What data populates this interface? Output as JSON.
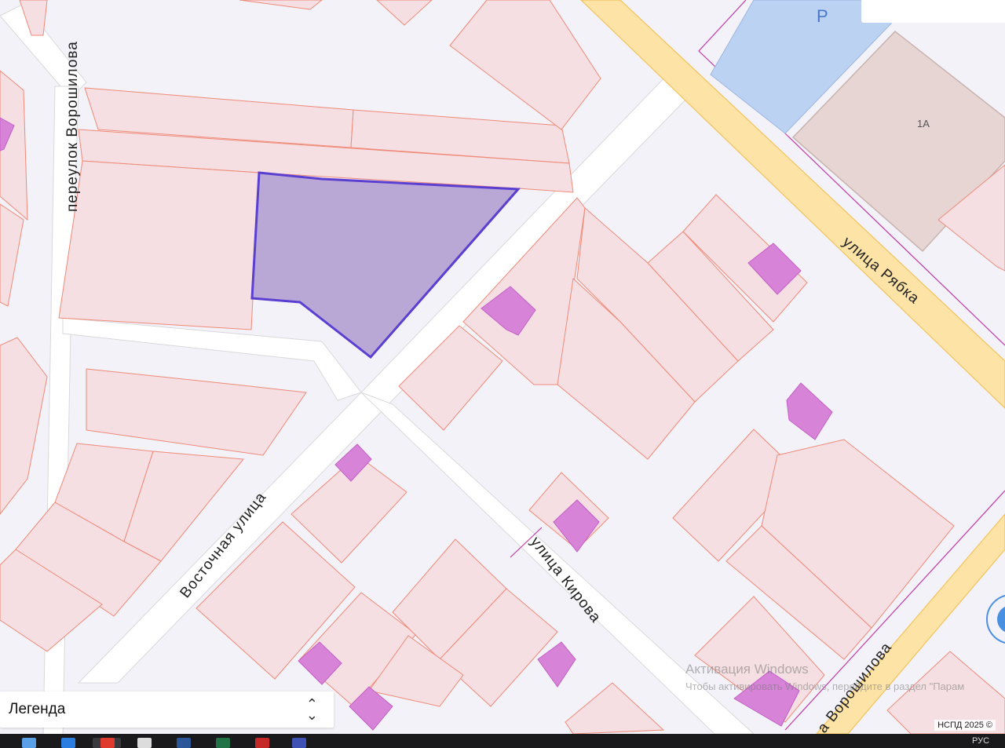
{
  "map": {
    "streets": {
      "vostochnaya": "Восточная улица",
      "kirova": "улица Кирова",
      "ryabka": "улица Рябка",
      "pereulok": "переулок Ворошилова",
      "voroshilova_cut": "а Ворошилова"
    },
    "parking_label": "P",
    "building_label": "1А",
    "selected_parcel_color": "#b9a8d6",
    "selected_parcel_stroke": "#5b3fd1",
    "parcel_fill": "#f5dfe2",
    "parcel_stroke": "#f08a78",
    "building_fill": "#d784d8",
    "road_color": "#fde3a6",
    "parking_color": "#bcd2f3"
  },
  "legend": {
    "label": "Легенда",
    "toggle_icon": "chevron-updown-icon"
  },
  "copyright": "НСПД 2025 ©",
  "watermark": {
    "title": "Активация Windows",
    "subtitle": "Чтобы активировать Windows, перейдите в раздел \"Парам"
  },
  "taskbar": {
    "icons": [
      "notes-icon",
      "edge-icon",
      "yandex-browser-icon",
      "chrome-icon",
      "word-icon",
      "excel-icon",
      "opera-icon",
      "save-icon"
    ],
    "lang": "РУС"
  }
}
